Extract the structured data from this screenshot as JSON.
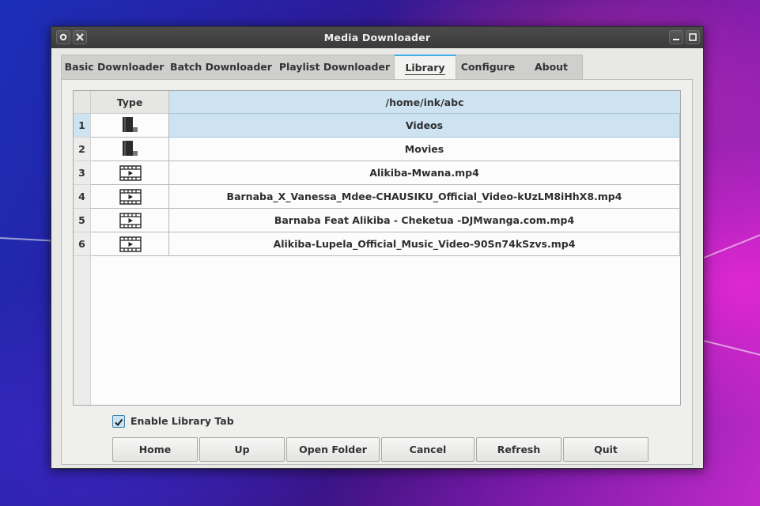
{
  "window": {
    "title": "Media Downloader"
  },
  "tabs": [
    {
      "label": "Basic Downloader"
    },
    {
      "label": "Batch Downloader"
    },
    {
      "label": "Playlist Downloader"
    },
    {
      "label": "Library"
    },
    {
      "label": "Configure"
    },
    {
      "label": "About"
    }
  ],
  "active_tab": "Library",
  "table": {
    "header_type": "Type",
    "header_path": "/home/ink/abc",
    "rows": [
      {
        "num": "1",
        "type_icon": "folder-icon",
        "name": "Videos"
      },
      {
        "num": "2",
        "type_icon": "folder-icon",
        "name": "Movies"
      },
      {
        "num": "3",
        "type_icon": "video-file-icon",
        "name": "Alikiba-Mwana.mp4"
      },
      {
        "num": "4",
        "type_icon": "video-file-icon",
        "name": "Barnaba_X_Vanessa_Mdee-CHAUSIKU_Official_Video-kUzLM8iHhX8.mp4"
      },
      {
        "num": "5",
        "type_icon": "video-file-icon",
        "name": "Barnaba Feat Alikiba - Cheketua -DJMwanga.com.mp4"
      },
      {
        "num": "6",
        "type_icon": "video-file-icon",
        "name": "Alikiba-Lupela_Official_Music_Video-90Sn74kSzvs.mp4"
      }
    ],
    "selected_row": "1"
  },
  "enable_library": {
    "label": "Enable Library Tab",
    "checked": true
  },
  "buttons": {
    "home": "Home",
    "up": "Up",
    "open_folder": "Open Folder",
    "cancel": "Cancel",
    "refresh": "Refresh",
    "quit": "Quit"
  },
  "colors": {
    "accent": "#3daee9",
    "selection": "#cde3f2",
    "titlebar": "#3f3f3f"
  }
}
